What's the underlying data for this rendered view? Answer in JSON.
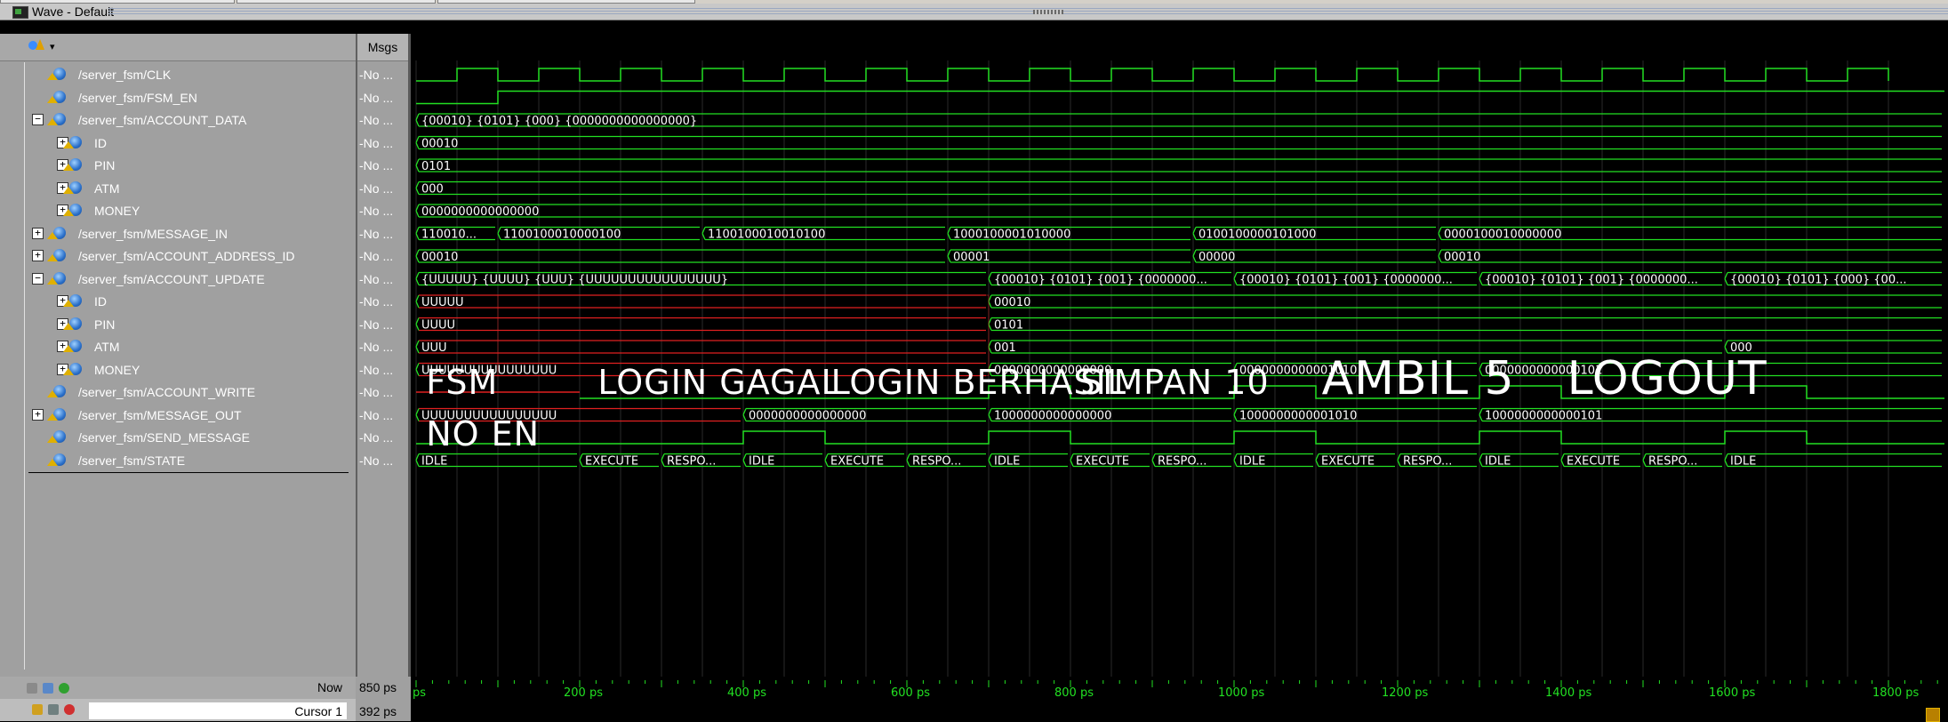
{
  "window": {
    "title": "Wave - Default"
  },
  "header": {
    "msgs_label": "Msgs"
  },
  "signals": [
    {
      "name": "/server_fsm/CLK",
      "msg": "-No ...",
      "expander": "",
      "indent": 0
    },
    {
      "name": "/server_fsm/FSM_EN",
      "msg": "-No ...",
      "expander": "",
      "indent": 0
    },
    {
      "name": "/server_fsm/ACCOUNT_DATA",
      "msg": "-No ...",
      "expander": "−",
      "indent": 0
    },
    {
      "name": "ID",
      "msg": "-No ...",
      "expander": "+",
      "indent": 1
    },
    {
      "name": "PIN",
      "msg": "-No ...",
      "expander": "+",
      "indent": 1
    },
    {
      "name": "ATM",
      "msg": "-No ...",
      "expander": "+",
      "indent": 1
    },
    {
      "name": "MONEY",
      "msg": "-No ...",
      "expander": "+",
      "indent": 1
    },
    {
      "name": "/server_fsm/MESSAGE_IN",
      "msg": "-No ...",
      "expander": "+",
      "indent": 0
    },
    {
      "name": "/server_fsm/ACCOUNT_ADDRESS_ID",
      "msg": "-No ...",
      "expander": "+",
      "indent": 0
    },
    {
      "name": "/server_fsm/ACCOUNT_UPDATE",
      "msg": "-No ...",
      "expander": "−",
      "indent": 0
    },
    {
      "name": "ID",
      "msg": "-No ...",
      "expander": "+",
      "indent": 1
    },
    {
      "name": "PIN",
      "msg": "-No ...",
      "expander": "+",
      "indent": 1
    },
    {
      "name": "ATM",
      "msg": "-No ...",
      "expander": "+",
      "indent": 1
    },
    {
      "name": "MONEY",
      "msg": "-No ...",
      "expander": "+",
      "indent": 1
    },
    {
      "name": "/server_fsm/ACCOUNT_WRITE",
      "msg": "-No ...",
      "expander": "",
      "indent": 0
    },
    {
      "name": "/server_fsm/MESSAGE_OUT",
      "msg": "-No ...",
      "expander": "+",
      "indent": 0
    },
    {
      "name": "/server_fsm/SEND_MESSAGE",
      "msg": "-No ...",
      "expander": "",
      "indent": 0
    },
    {
      "name": "/server_fsm/STATE",
      "msg": "-No ...",
      "expander": "",
      "indent": 0
    }
  ],
  "waves": {
    "account_data": "{00010} {0101} {000} {0000000000000000}",
    "account_data_id": "00010",
    "account_data_pin": "0101",
    "account_data_atm": "000",
    "account_data_money": "0000000000000000",
    "message_in": [
      {
        "t": 0,
        "v": "110010..."
      },
      {
        "t": 100,
        "v": "1100100010000100"
      },
      {
        "t": 350,
        "v": "1100100010010100"
      },
      {
        "t": 650,
        "v": "1000100001010000"
      },
      {
        "t": 950,
        "v": "0100100000101000"
      },
      {
        "t": 1250,
        "v": "0000100010000000"
      }
    ],
    "address_id": [
      {
        "t": 0,
        "v": "00010"
      },
      {
        "t": 650,
        "v": "00001"
      },
      {
        "t": 950,
        "v": "00000"
      },
      {
        "t": 1250,
        "v": "00010"
      }
    ],
    "account_update": [
      {
        "t": 0,
        "v": "{UUUUU} {UUUU} {UUU} {UUUUUUUUUUUUUUUU}"
      },
      {
        "t": 700,
        "v": "{00010} {0101} {001} {0000000..."
      },
      {
        "t": 1000,
        "v": "{00010} {0101} {001} {0000000..."
      },
      {
        "t": 1300,
        "v": "{00010} {0101} {001} {0000000..."
      },
      {
        "t": 1600,
        "v": "{00010} {0101} {000} {00..."
      }
    ],
    "update_id": [
      {
        "t": 0,
        "v": "UUUUU"
      },
      {
        "t": 700,
        "v": "00010"
      }
    ],
    "update_pin": [
      {
        "t": 0,
        "v": "UUUU"
      },
      {
        "t": 700,
        "v": "0101"
      }
    ],
    "update_atm": [
      {
        "t": 0,
        "v": "UUU"
      },
      {
        "t": 700,
        "v": "001"
      },
      {
        "t": 1600,
        "v": "000"
      }
    ],
    "update_money": [
      {
        "t": 0,
        "v": "UUUUUUUUUUUUUUUU"
      },
      {
        "t": 700,
        "v": "0000000000000000"
      },
      {
        "t": 1000,
        "v": "0000000000001010"
      },
      {
        "t": 1300,
        "v": "0000000000000101"
      }
    ],
    "message_out": [
      {
        "t": 0,
        "v": "UUUUUUUUUUUUUUUU"
      },
      {
        "t": 400,
        "v": "0000000000000000"
      },
      {
        "t": 700,
        "v": "1000000000000000"
      },
      {
        "t": 1000,
        "v": "1000000000001010"
      },
      {
        "t": 1300,
        "v": "1000000000000101"
      }
    ],
    "state": [
      {
        "t": 0,
        "v": "IDLE"
      },
      {
        "t": 200,
        "v": "EXECUTE"
      },
      {
        "t": 300,
        "v": "RESPO..."
      },
      {
        "t": 400,
        "v": "IDLE"
      },
      {
        "t": 500,
        "v": "EXECUTE"
      },
      {
        "t": 600,
        "v": "RESPO..."
      },
      {
        "t": 700,
        "v": "IDLE"
      },
      {
        "t": 800,
        "v": "EXECUTE"
      },
      {
        "t": 900,
        "v": "RESPO..."
      },
      {
        "t": 1000,
        "v": "IDLE"
      },
      {
        "t": 1100,
        "v": "EXECUTE"
      },
      {
        "t": 1200,
        "v": "RESPO..."
      },
      {
        "t": 1300,
        "v": "IDLE"
      },
      {
        "t": 1400,
        "v": "EXECUTE"
      },
      {
        "t": 1500,
        "v": "RESPO..."
      },
      {
        "t": 1600,
        "v": "IDLE"
      }
    ]
  },
  "annotations": [
    {
      "text": "FSM",
      "t": 10,
      "row": 0,
      "size": "small"
    },
    {
      "text": "NO EN",
      "t": 10,
      "row": 1,
      "size": "small"
    },
    {
      "text": "LOGIN GAGAL",
      "t": 220,
      "row": 0,
      "size": "small"
    },
    {
      "text": "LOGIN BERHASIL",
      "t": 505,
      "row": 0,
      "size": "small"
    },
    {
      "text": "SIMPAN 10",
      "t": 810,
      "row": 0,
      "size": "small"
    },
    {
      "text": "AMBIL 5",
      "t": 1105,
      "row": 0,
      "size": "large"
    },
    {
      "text": "LOGOUT",
      "t": 1405,
      "row": 0,
      "size": "large"
    }
  ],
  "timeline": {
    "ticks": [
      {
        "t": 0,
        "label": "ps"
      },
      {
        "t": 200,
        "label": "200 ps"
      },
      {
        "t": 400,
        "label": "400 ps"
      },
      {
        "t": 600,
        "label": "600 ps"
      },
      {
        "t": 800,
        "label": "800 ps"
      },
      {
        "t": 1000,
        "label": "1000 ps"
      },
      {
        "t": 1200,
        "label": "1200 ps"
      },
      {
        "t": 1400,
        "label": "1400 ps"
      },
      {
        "t": 1600,
        "label": "1600 ps"
      },
      {
        "t": 1800,
        "label": "1800 ps"
      }
    ]
  },
  "footer": {
    "now_label": "Now",
    "now_value": "850 ps",
    "cursor_label": "Cursor 1",
    "cursor_value": "392 ps"
  },
  "colors": {
    "wave": "#22e022",
    "unknown": "#e02020",
    "background": "#000000",
    "cursor_line": "#808080",
    "label": "#ffffff"
  }
}
